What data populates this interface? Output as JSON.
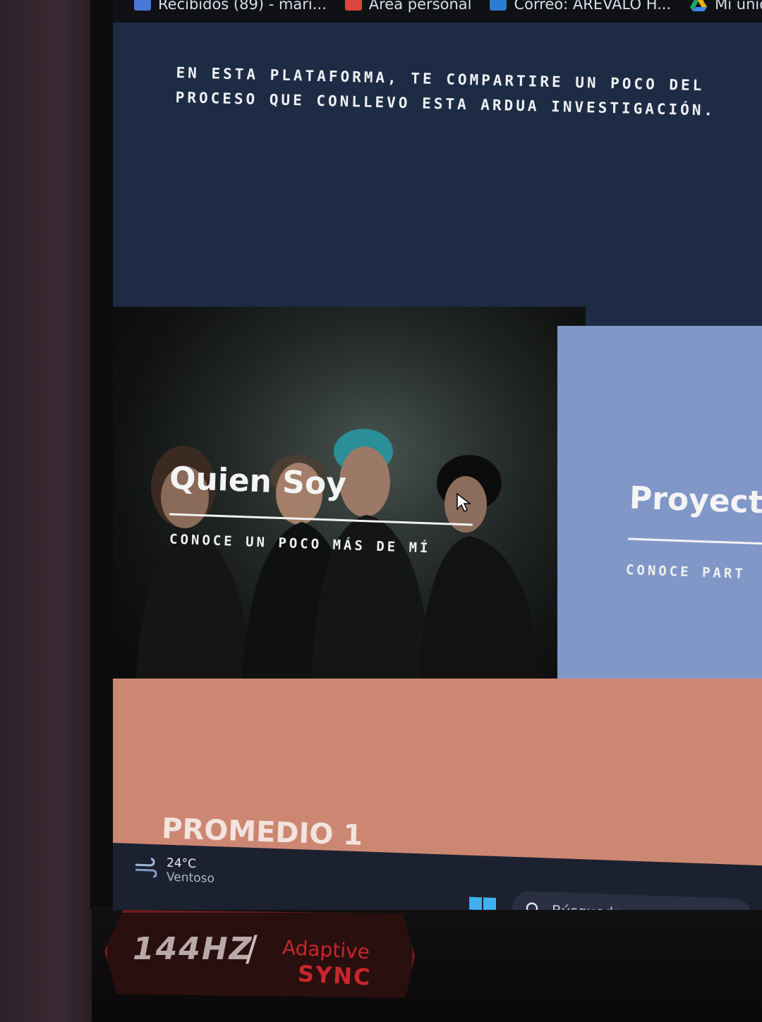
{
  "bookmarks": [
    {
      "label": "Recibidos (89) - mari...",
      "icon": "gmail-icon",
      "color": "#4a78d8"
    },
    {
      "label": "Área personal",
      "icon": "moodle-icon",
      "color": "#d9453f"
    },
    {
      "label": "Correo: AREVALO H...",
      "icon": "outlook-icon",
      "color": "#2b7cd3"
    },
    {
      "label": "Mi unidad",
      "icon": "google-drive-icon",
      "color": "#f2b400"
    }
  ],
  "hero": {
    "text": "EN ESTA PLATAFORMA, TE COMPARTIRE UN POCO DEL PROCESO QUE CONLLEVO ESTA ARDUA INVESTIGACIÓN."
  },
  "cards": {
    "quien_soy": {
      "title": "Quien Soy",
      "subtitle": "CONOCE UN POCO MÁS DE MÍ"
    },
    "proyecto": {
      "title": "Proyect",
      "subtitle": "CONOCE PART"
    }
  },
  "promedio": {
    "title": "PROMEDIO 1"
  },
  "taskbar": {
    "weather_temp": "24°C",
    "weather_desc": "Ventoso",
    "search_label": "Búsqueda"
  },
  "sticker": {
    "refresh": "144HZ",
    "slash": "/",
    "adaptive": "Adaptive",
    "sync": "SYNC"
  },
  "colors": {
    "hero_bg": "#1e2b44",
    "proyecto_bg": "#8197c8",
    "promedio_bg": "#cc8773",
    "sticker_red": "#c8262b"
  }
}
